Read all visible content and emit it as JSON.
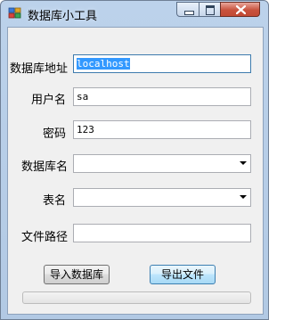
{
  "window": {
    "title": "数据库小工具",
    "controls": {
      "minimize": "minimize-icon",
      "maximize": "maximize-icon",
      "close": "close-icon"
    }
  },
  "form": {
    "server": {
      "label": "数据库地址",
      "value": "localhost"
    },
    "username": {
      "label": "用户名",
      "value": "sa"
    },
    "password": {
      "label": "密码",
      "value": "123"
    },
    "database": {
      "label": "数据库名",
      "value": ""
    },
    "table": {
      "label": "表名",
      "value": ""
    },
    "file_path": {
      "label": "文件路径",
      "value": ""
    }
  },
  "buttons": {
    "import_label": "导入数据库",
    "export_label": "导出文件"
  },
  "progress": {
    "value": 0
  },
  "colors": {
    "selection": "#3399ff",
    "client_bg": "#f0f0f0",
    "close_button": "#c8523d"
  }
}
